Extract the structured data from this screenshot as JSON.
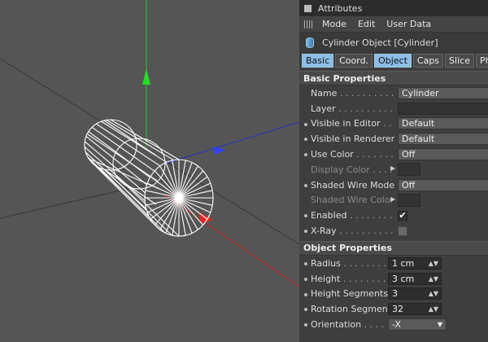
{
  "panel": {
    "title": "Attributes",
    "menu": [
      "Mode",
      "Edit",
      "User Data"
    ],
    "object_title": "Cylinder Object [Cylinder]",
    "tabs": [
      "Basic",
      "Coord.",
      "Object",
      "Caps",
      "Slice",
      "Phong"
    ],
    "active_tabs": [
      "Basic",
      "Object"
    ],
    "basic_section": "Basic Properties",
    "basic": [
      {
        "label": "Name",
        "dots": " . . . . . . . . . . .",
        "value": "Cylinder"
      },
      {
        "label": "Layer",
        "dots": " . . . . . . . . . . .",
        "value": ""
      },
      {
        "label": "Visible in Editor",
        "dots": " . . . . .",
        "value": "Default"
      },
      {
        "label": "Visible in Renderer",
        "dots": " . .",
        "value": "Default"
      },
      {
        "label": "Use Color",
        "dots": " . . . . . . . .",
        "value": "Off"
      },
      {
        "label": "Display Color",
        "dots": " . . . .",
        "value": ""
      },
      {
        "label": "Shaded Wire Mode",
        "dots": "",
        "value": "Off"
      },
      {
        "label": "Shaded Wire Color",
        "dots": "",
        "value": ""
      },
      {
        "label": "Enabled",
        "dots": " . . . . . . . . . . .",
        "value": "✔"
      },
      {
        "label": "X-Ray",
        "dots": " . . . . . . . . . . .",
        "value": ""
      }
    ],
    "object_section": "Object Properties",
    "object": [
      {
        "label": "Radius",
        "dots": " . . . . . . . . . .",
        "value": "1 cm"
      },
      {
        "label": "Height",
        "dots": " . . . . . . . . . .",
        "value": "3 cm"
      },
      {
        "label": "Height Segments",
        "dots": "",
        "value": "3"
      },
      {
        "label": "Rotation Segments",
        "dots": "",
        "value": "32"
      },
      {
        "label": "Orientation",
        "dots": " . . . . . . .",
        "value": "-X"
      }
    ]
  },
  "icons": {
    "title": "window-square-icon",
    "menu": "grip-icon",
    "object": "cylinder-icon",
    "spinner": "spinner-arrows-icon",
    "dropdown": "chevron-down-icon"
  },
  "colors": {
    "panel_bg": "#3e3e3e",
    "viewport_bg": "#555555",
    "active_tab": "#8cbde6",
    "axis_x": "#cc2222",
    "axis_y": "#22cc22",
    "axis_z": "#2233cc"
  }
}
